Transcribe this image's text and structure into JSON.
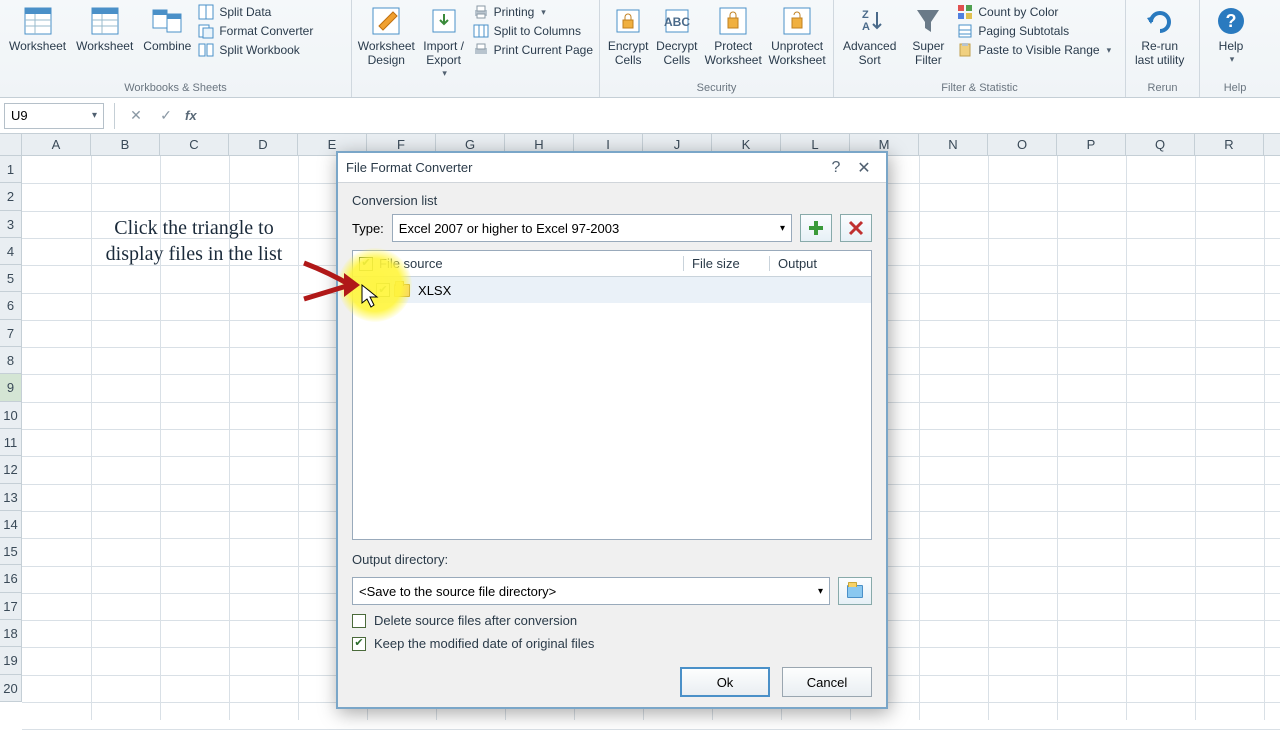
{
  "ribbon": {
    "groups": {
      "workbooks": {
        "label": "Workbooks & Sheets",
        "big": {
          "worksheet1": "Worksheet",
          "worksheet2": "Worksheet",
          "combine": "Combine"
        },
        "small": {
          "split_data": "Split Data",
          "format_converter": "Format Converter",
          "split_workbook": "Split Workbook"
        }
      },
      "design_export": {
        "big": {
          "design": "Worksheet\nDesign",
          "import_export": "Import /\nExport"
        },
        "small": {
          "printing": "Printing",
          "split_cols": "Split to Columns",
          "print_page": "Print Current Page"
        }
      },
      "security": {
        "label": "Security",
        "big": {
          "encrypt": "Encrypt\nCells",
          "decrypt": "Decrypt\nCells",
          "protect": "Protect\nWorksheet",
          "unprotect": "Unprotect\nWorksheet"
        }
      },
      "filter": {
        "label": "Filter & Statistic",
        "big": {
          "adv_sort": "Advanced\nSort",
          "super_filter": "Super\nFilter"
        },
        "small": {
          "count_color": "Count by Color",
          "paging_sub": "Paging Subtotals",
          "paste_visible": "Paste to Visible Range"
        }
      },
      "rerun": {
        "label": "Rerun",
        "big": {
          "rerun": "Re-run\nlast utility"
        }
      },
      "help": {
        "label": "Help",
        "big": {
          "help": "Help"
        }
      }
    }
  },
  "formula_bar": {
    "name_box": "U9",
    "formula": ""
  },
  "grid": {
    "columns": [
      "A",
      "B",
      "C",
      "D",
      "E",
      "F",
      "G",
      "H",
      "I",
      "J",
      "K",
      "L",
      "M",
      "N",
      "O",
      "P",
      "Q",
      "R"
    ],
    "rows": [
      "1",
      "2",
      "3",
      "4",
      "5",
      "6",
      "7",
      "8",
      "9",
      "10",
      "11",
      "12",
      "13",
      "14",
      "15",
      "16",
      "17",
      "18",
      "19",
      "20"
    ],
    "selected_row": "9"
  },
  "instruction": "Click the triangle to display files in the list",
  "dialog": {
    "title": "File Format Converter",
    "section": "Conversion list",
    "type_label": "Type:",
    "type_value": "Excel 2007 or higher to Excel 97-2003",
    "columns": {
      "source": "File source",
      "size": "File size",
      "output": "Output"
    },
    "item": "XLSX",
    "output_label": "Output directory:",
    "output_value": "<Save to the source file directory>",
    "delete_label": "Delete source files after conversion",
    "keep_label": "Keep the modified date of original files",
    "ok": "Ok",
    "cancel": "Cancel"
  }
}
